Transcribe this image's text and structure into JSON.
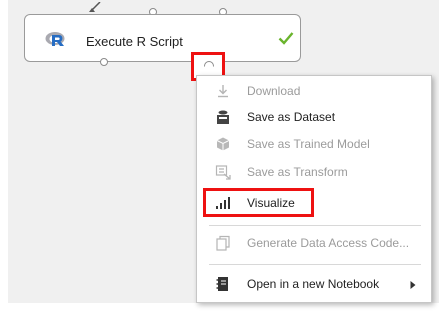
{
  "module": {
    "title": "Execute R Script",
    "status_icon": "check-icon",
    "colors": {
      "status_ok": "#6ab42d",
      "r_logo": "#276dc3"
    }
  },
  "context_menu": {
    "items": [
      {
        "label": "Download",
        "icon": "download-icon",
        "enabled": false
      },
      {
        "label": "Save as Dataset",
        "icon": "save-dataset-icon",
        "enabled": true
      },
      {
        "label": "Save as Trained Model",
        "icon": "trained-model-icon",
        "enabled": false
      },
      {
        "label": "Save as Transform",
        "icon": "transform-icon",
        "enabled": false
      },
      {
        "label": "Visualize",
        "icon": "visualize-icon",
        "enabled": true
      },
      {
        "label": "Generate Data Access Code...",
        "icon": "data-access-code-icon",
        "enabled": false
      },
      {
        "label": "Open in a new Notebook",
        "icon": "notebook-icon",
        "enabled": true,
        "has_submenu": true
      }
    ]
  },
  "highlight_color": "#ee1111"
}
